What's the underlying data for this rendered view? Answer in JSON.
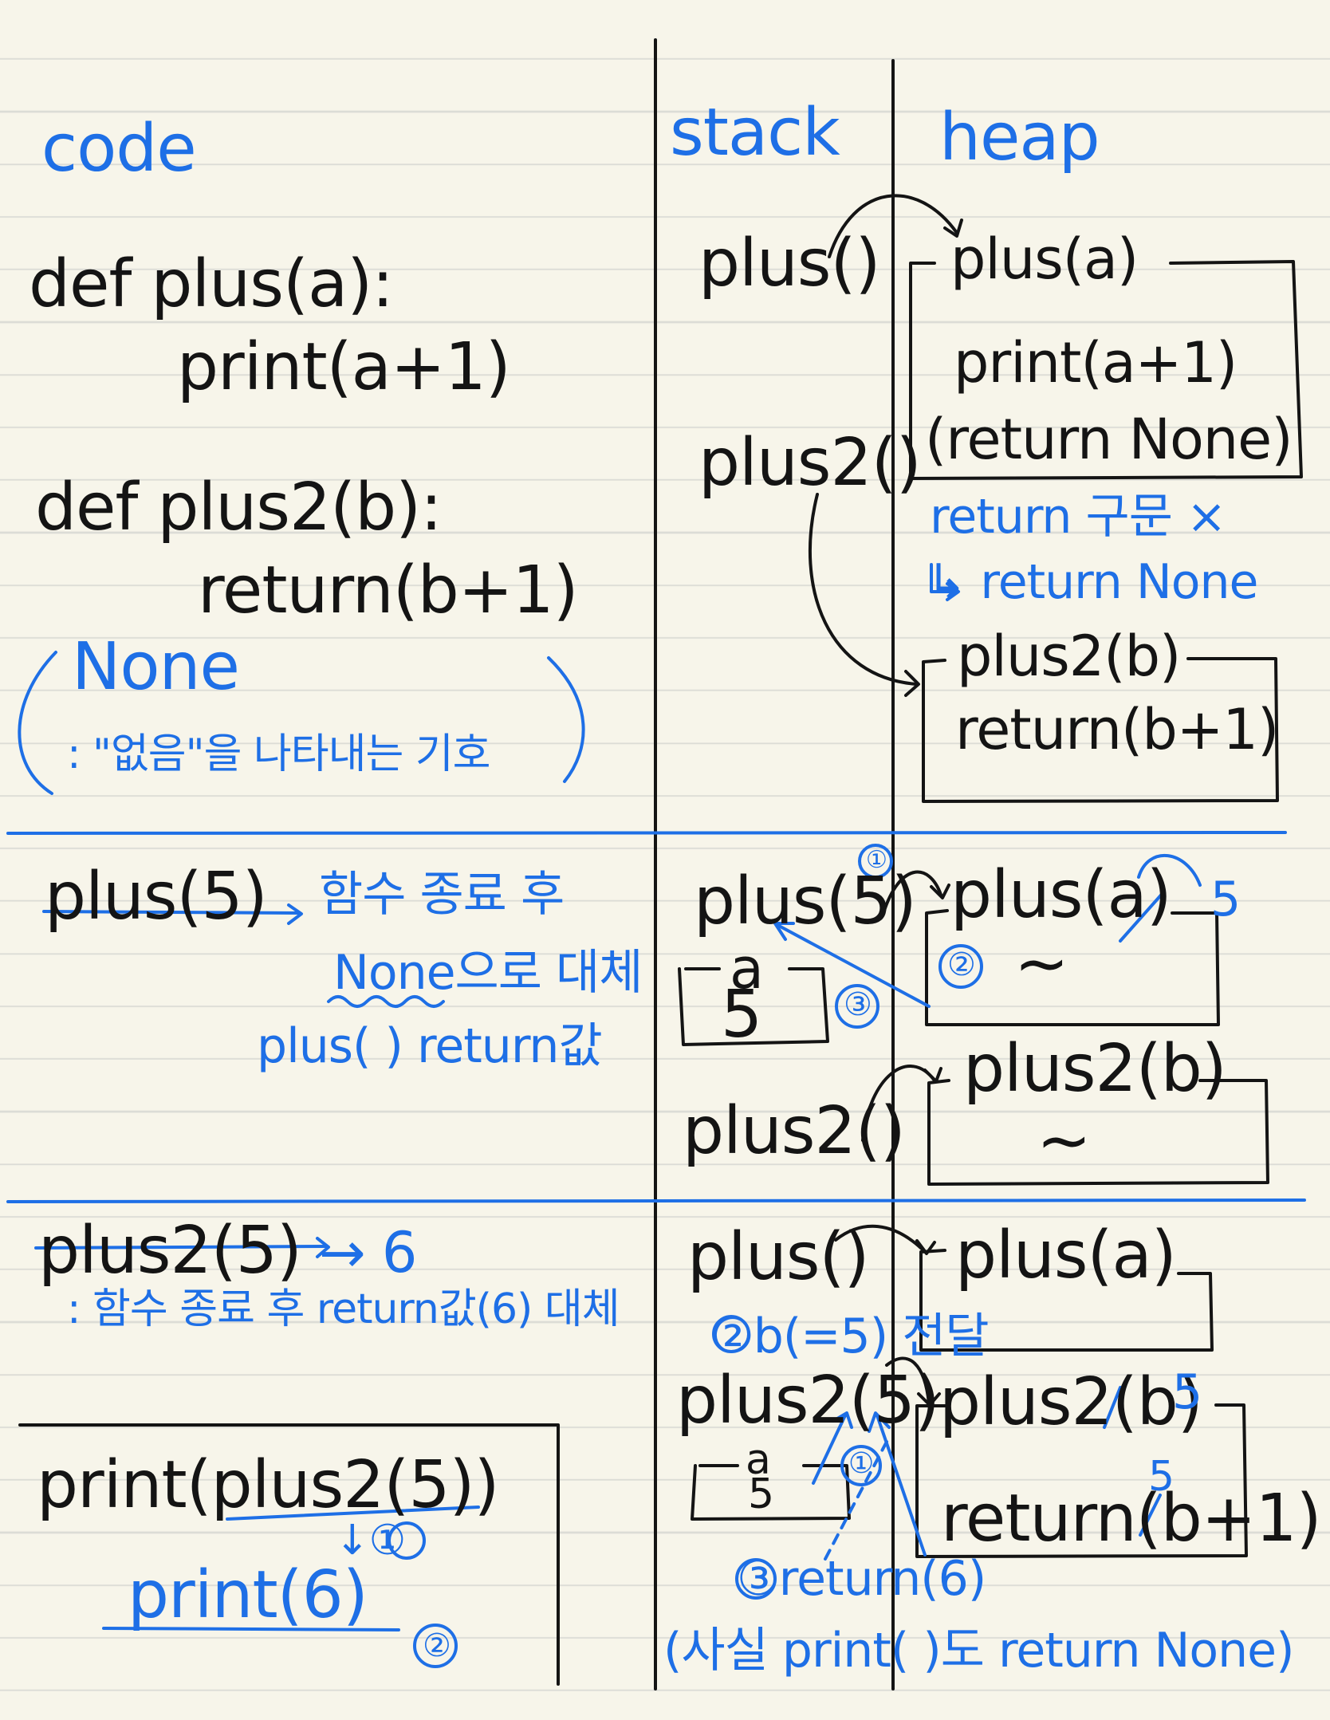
{
  "headers": {
    "code": "code",
    "stack": "stack",
    "heap": "heap"
  },
  "section1": {
    "code": {
      "def_plus": "def plus(a):",
      "print_body": "print(a+1)",
      "def_plus2": "def plus2(b):",
      "return_body": "return(b+1)",
      "none_title": "None",
      "none_desc": ": \"없음\"을 나타내는 기호"
    },
    "stack": {
      "plus": "plus()",
      "plus2": "plus2()"
    },
    "heap": {
      "plus_header": "plus(a)",
      "plus_print": "print(a+1)",
      "plus_return": "(return None)",
      "note_line1": "return 구문 ×",
      "note_line2": "↳ return None",
      "plus2_header": "plus2(b)",
      "plus2_return": "return(b+1)"
    }
  },
  "section2": {
    "code": {
      "call": "plus(5)",
      "arrow": "→",
      "note1": "함수 종료 후",
      "note2": "None으로 대체",
      "note3": "plus( ) return값"
    },
    "stack": {
      "plus": "plus(5)",
      "step1": "①",
      "var_name": "a",
      "var_value": "5",
      "step3": "③",
      "plus2": "plus2()"
    },
    "heap": {
      "plus_header": "plus(a)",
      "arg_value": "5",
      "step2": "②",
      "plus_body": "~",
      "plus2_header": "plus2(b)",
      "plus2_body": "~"
    }
  },
  "section3": {
    "code": {
      "call": "plus2(5)",
      "result": "→ 6",
      "note": ": 함수 종료 후 return값(6) 대체",
      "print_expr": "print(plus2(5))",
      "step1": "↓①",
      "print6": "print(6)",
      "step2": "②"
    },
    "stack": {
      "plus": "plus()",
      "pass_note": "②b(=5) 전달",
      "plus2": "plus2(5)",
      "var_name": "a",
      "var_value": "5",
      "step1": "①",
      "return_note": "③return(6)",
      "aside": "(사실 print( )도 return None)"
    },
    "heap": {
      "plus_header": "plus(a)",
      "plus2_header": "plus2(b)",
      "arg_value": "5",
      "return_value": "5",
      "plus2_return": "return(b+1)"
    }
  },
  "colors": {
    "ink": "#141414",
    "pen_blue": "#1e6fe6",
    "paper": "#f7f5ea",
    "rule": "#dcdcd6"
  }
}
